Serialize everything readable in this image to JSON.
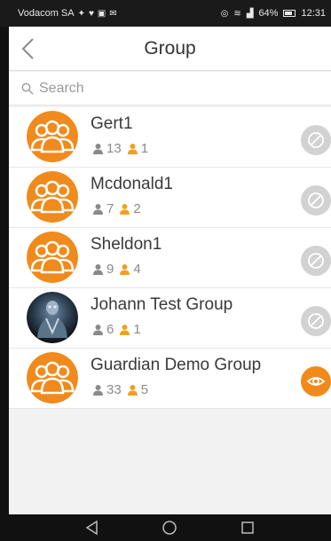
{
  "statusbar": {
    "carrier": "Vodacom SA",
    "battery": "64%",
    "time": "12:31"
  },
  "header": {
    "title": "Group"
  },
  "search": {
    "placeholder": "Search"
  },
  "groups": [
    {
      "name": "Gert1",
      "members": "13",
      "admins": "1",
      "avatar": "group-avatar",
      "action": "disabled"
    },
    {
      "name": "Mcdonald1",
      "members": "7",
      "admins": "2",
      "avatar": "group-avatar",
      "action": "disabled"
    },
    {
      "name": "Sheldon1",
      "members": "9",
      "admins": "4",
      "avatar": "group-avatar",
      "action": "disabled"
    },
    {
      "name": "Johann Test Group",
      "members": "6",
      "admins": "1",
      "avatar": "robot-photo",
      "action": "disabled"
    },
    {
      "name": "Guardian Demo Group",
      "members": "33",
      "admins": "5",
      "avatar": "group-avatar",
      "action": "active"
    }
  ],
  "colors": {
    "accent": "#f08a1c",
    "disabled": "#d2d2d2",
    "member_icon": "#8a8a8a",
    "admin_icon": "#f0a020"
  }
}
